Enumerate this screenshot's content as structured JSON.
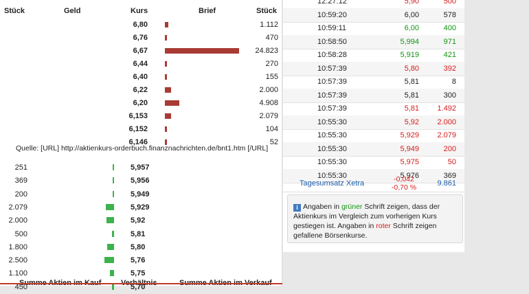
{
  "orderbook": {
    "headers": {
      "stueck_left": "Stück",
      "geld": "Geld",
      "kurs": "Kurs",
      "brief": "Brief",
      "stueck_right": "Stück"
    },
    "asks": [
      {
        "kurs": "6,80",
        "stueck": "1.112",
        "quantity": 1112
      },
      {
        "kurs": "6,76",
        "stueck": "470",
        "quantity": 470
      },
      {
        "kurs": "6,67",
        "stueck": "24.823",
        "quantity": 24823
      },
      {
        "kurs": "6,44",
        "stueck": "270",
        "quantity": 270
      },
      {
        "kurs": "6,40",
        "stueck": "155",
        "quantity": 155
      },
      {
        "kurs": "6,22",
        "stueck": "2.000",
        "quantity": 2000
      },
      {
        "kurs": "6,20",
        "stueck": "4.908",
        "quantity": 4908
      },
      {
        "kurs": "6,153",
        "stueck": "2.079",
        "quantity": 2079
      },
      {
        "kurs": "6,152",
        "stueck": "104",
        "quantity": 104
      },
      {
        "kurs": "6,146",
        "stueck": "52",
        "quantity": 52
      }
    ],
    "source_text": "Quelle: [URL] http://aktienkurs-orderbuch.finanznachrichten.de/bnt1.htm [/URL]",
    "bids": [
      {
        "stueck": "251",
        "kurs": "5,957",
        "quantity": 251
      },
      {
        "stueck": "369",
        "kurs": "5,956",
        "quantity": 369
      },
      {
        "stueck": "200",
        "kurs": "5,949",
        "quantity": 200
      },
      {
        "stueck": "2.079",
        "kurs": "5,929",
        "quantity": 2079
      },
      {
        "stueck": "2.000",
        "kurs": "5,92",
        "quantity": 2000
      },
      {
        "stueck": "500",
        "kurs": "5,81",
        "quantity": 500
      },
      {
        "stueck": "1.800",
        "kurs": "5,80",
        "quantity": 1800
      },
      {
        "stueck": "2.500",
        "kurs": "5,76",
        "quantity": 2500
      },
      {
        "stueck": "1.100",
        "kurs": "5,75",
        "quantity": 1100
      },
      {
        "stueck": "450",
        "kurs": "5,70",
        "quantity": 450
      }
    ],
    "footer": {
      "kauf": "Summe Aktien im Kauf",
      "verhaeltnis": "Verhältnis",
      "verkauf": "Summe Aktien im Verkauf"
    }
  },
  "trades": [
    {
      "time": "12:27:12",
      "price": "5,90",
      "volume": "500",
      "dir": "down"
    },
    {
      "time": "10:59:20",
      "price": "6,00",
      "volume": "578",
      "dir": "neutral"
    },
    {
      "time": "10:59:11",
      "price": "6,00",
      "volume": "400",
      "dir": "up"
    },
    {
      "time": "10:58:50",
      "price": "5,994",
      "volume": "971",
      "dir": "up"
    },
    {
      "time": "10:58:28",
      "price": "5,919",
      "volume": "421",
      "dir": "up"
    },
    {
      "time": "10:57:39",
      "price": "5,80",
      "volume": "392",
      "dir": "down"
    },
    {
      "time": "10:57:39",
      "price": "5,81",
      "volume": "8",
      "dir": "neutral"
    },
    {
      "time": "10:57:39",
      "price": "5,81",
      "volume": "300",
      "dir": "neutral"
    },
    {
      "time": "10:57:39",
      "price": "5,81",
      "volume": "1.492",
      "dir": "down"
    },
    {
      "time": "10:55:30",
      "price": "5,92",
      "volume": "2.000",
      "dir": "down"
    },
    {
      "time": "10:55:30",
      "price": "5,929",
      "volume": "2.079",
      "dir": "down"
    },
    {
      "time": "10:55:30",
      "price": "5,949",
      "volume": "200",
      "dir": "down"
    },
    {
      "time": "10:55:30",
      "price": "5,975",
      "volume": "50",
      "dir": "down"
    },
    {
      "time": "10:55:30",
      "price": "5,976",
      "volume": "369",
      "dir": "neutral"
    }
  ],
  "summary": {
    "label": "Tagesumsatz Xetra",
    "change_abs": "-0,042",
    "change_pct": "-0,70 %",
    "total": "9.861"
  },
  "info": {
    "icon": "info-icon",
    "part1": "Angaben in ",
    "green_word": "grüner",
    "part2": " Schrift zeigen, dass der Aktienkurs im Vergleich zum vorherigen Kurs gestiegen ist. Angaben in ",
    "red_word": "roter",
    "part3": " Schrift zeigen gefallene Börsenkurse."
  },
  "colors": {
    "ask_bar": "#a83b34",
    "bid_bar": "#3db24d",
    "up": "#129412",
    "down": "#d61c1c",
    "label_blue": "#1f5ea8"
  }
}
